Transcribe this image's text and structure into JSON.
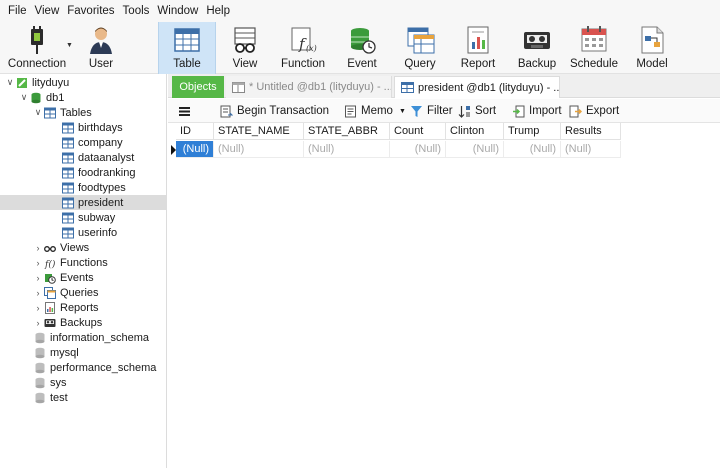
{
  "menu": [
    "File",
    "View",
    "Favorites",
    "Tools",
    "Window",
    "Help"
  ],
  "toolbar": {
    "connection": "Connection",
    "user": "User",
    "table": "Table",
    "view": "View",
    "function": "Function",
    "event": "Event",
    "query": "Query",
    "report": "Report",
    "backup": "Backup",
    "schedule": "Schedule",
    "model": "Model"
  },
  "tree": {
    "connection": "lityduyu",
    "database": "db1",
    "tables_label": "Tables",
    "tables": [
      "birthdays",
      "company",
      "dataanalyst",
      "foodranking",
      "foodtypes",
      "president",
      "subway",
      "userinfo"
    ],
    "selected_table": "president",
    "groups": [
      "Views",
      "Functions",
      "Events",
      "Queries",
      "Reports",
      "Backups"
    ],
    "other_databases": [
      "information_schema",
      "mysql",
      "performance_schema",
      "sys",
      "test"
    ]
  },
  "tabs": {
    "objects": "Objects",
    "untitled": "* Untitled @db1 (lityduyu) - ...",
    "president": "president @db1 (lityduyu) - ..."
  },
  "data_toolbar": {
    "begin_transaction": "Begin Transaction",
    "memo": "Memo",
    "filter": "Filter",
    "sort": "Sort",
    "import": "Import",
    "export": "Export"
  },
  "grid": {
    "columns": [
      "ID",
      "STATE_NAME",
      "STATE_ABBR",
      "Count",
      "Clinton",
      "Trump",
      "Results"
    ],
    "rows": [
      [
        "(Null)",
        "(Null)",
        "(Null)",
        "(Null)",
        "(Null)",
        "(Null)",
        "(Null)"
      ]
    ]
  },
  "colors": {
    "objects_tab": "#56b847",
    "selected_cell": "#2f7fd6",
    "active_toolbar": "#cfe4f7"
  }
}
